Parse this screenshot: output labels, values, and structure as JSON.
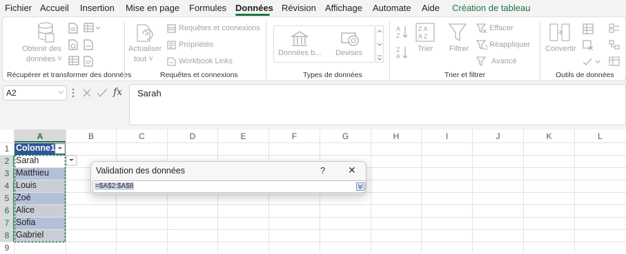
{
  "menu": {
    "items": [
      "Fichier",
      "Accueil",
      "Insertion",
      "Mise en page",
      "Formules",
      "Données",
      "Révision",
      "Affichage",
      "Automate",
      "Aide",
      "Création de tableau"
    ],
    "active": "Données"
  },
  "ribbon": {
    "get_data": {
      "label_line1": "Obtenir des",
      "label_line2": "données ˅"
    },
    "refresh": {
      "label_line1": "Actualiser",
      "label_line2": "tout ˅"
    },
    "queries": {
      "item1": "Requêtes et connexions",
      "item2": "Propriétés",
      "item3": "Workbook Links"
    },
    "data_types": {
      "stocks": "Données b...",
      "currencies": "Devises"
    },
    "sort_filter": {
      "sort": "Trier",
      "filter": "Filtrer",
      "clear": "Effacer",
      "reapply": "Réappliquer",
      "advanced": "Avancé"
    },
    "tools": {
      "convert": "Convertir"
    },
    "groups": {
      "g1": "Récupérer et transformer des données",
      "g2": "Requêtes et connexions",
      "g3": "Types de données",
      "g4": "Trier et filtrer",
      "g5": "Outils de données"
    }
  },
  "formula_bar": {
    "namebox": "A2",
    "fx_label": "fx",
    "content": "Sarah"
  },
  "grid": {
    "columns": [
      "A",
      "B",
      "C",
      "D",
      "E",
      "F",
      "G",
      "H",
      "I",
      "J",
      "K",
      "L"
    ],
    "rows": [
      "1",
      "2",
      "3",
      "4",
      "5",
      "6",
      "7",
      "8",
      "9"
    ],
    "header_cell": "Colonne1",
    "values": [
      "Sarah",
      "Matthieu",
      "Louis",
      "Zoé",
      "Alice",
      "Sofia",
      "Gabriel"
    ]
  },
  "dialog": {
    "title": "Validation des données",
    "help": "?",
    "close": "✕",
    "value": "=$A$2:$A$8"
  },
  "colors": {
    "accent": "#1a7343",
    "table_header": "#2f5597",
    "selection": "#c6cbd6"
  }
}
